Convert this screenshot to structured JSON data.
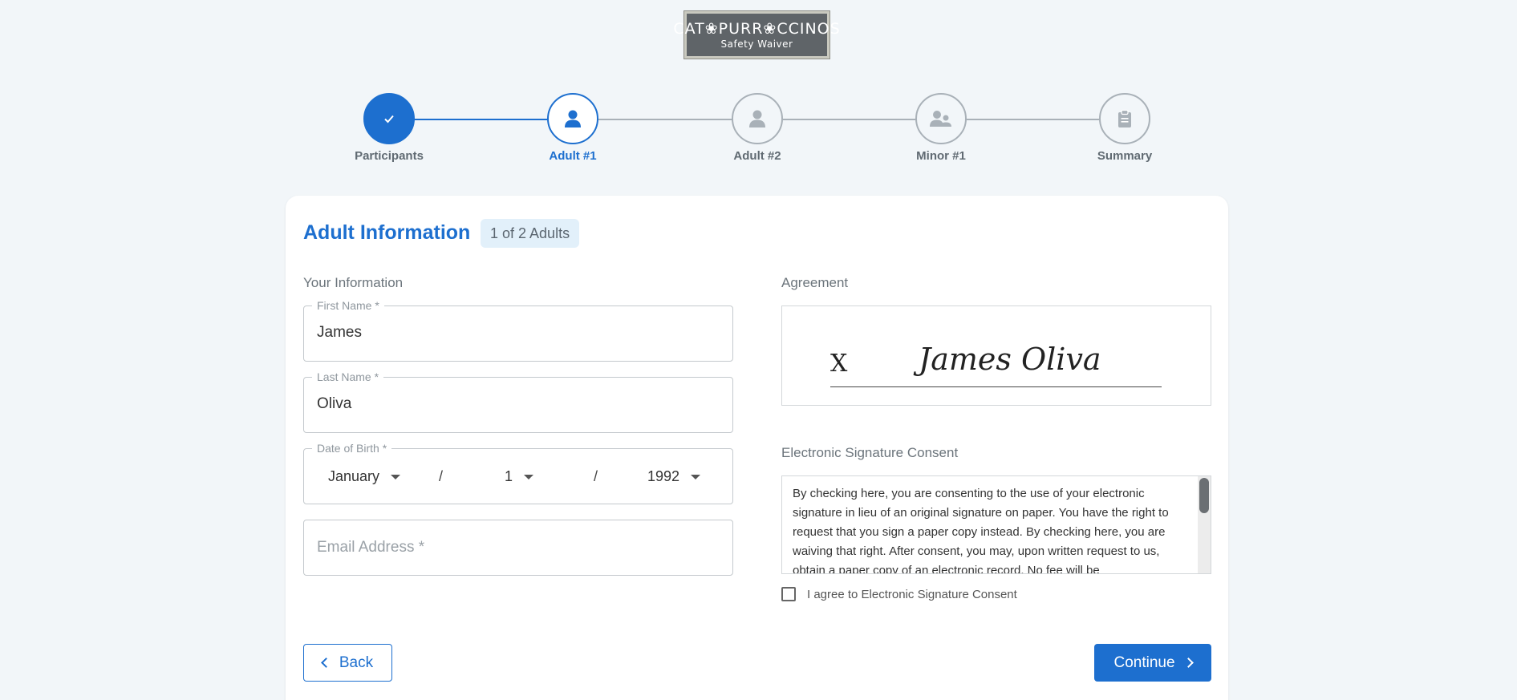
{
  "logo": {
    "title": "CAT❀PURR❀CCINOS",
    "subtitle": "Safety Waiver"
  },
  "stepper": {
    "steps": [
      {
        "label": "Participants",
        "state": "done",
        "icon": "check-icon"
      },
      {
        "label": "Adult #1",
        "state": "current",
        "icon": "person-icon"
      },
      {
        "label": "Adult #2",
        "state": "upcoming",
        "icon": "person-icon"
      },
      {
        "label": "Minor #1",
        "state": "upcoming",
        "icon": "person-child-icon"
      },
      {
        "label": "Summary",
        "state": "upcoming",
        "icon": "clipboard-icon"
      }
    ]
  },
  "card": {
    "title": "Adult Information",
    "badge": "1 of 2 Adults",
    "your_info_label": "Your Information",
    "first_name": {
      "label": "First Name *",
      "value": "James"
    },
    "last_name": {
      "label": "Last Name *",
      "value": "Oliva"
    },
    "dob": {
      "label": "Date of Birth *",
      "month": "January",
      "day": "1",
      "year": "1992",
      "separator": "/"
    },
    "email": {
      "placeholder": "Email Address *",
      "value": ""
    },
    "agreement_label": "Agreement",
    "signature": {
      "prefix": "X",
      "name": "James Oliva"
    },
    "consent_label": "Electronic Signature Consent",
    "consent_text": "By checking here, you are consenting to the use of your electronic signature in lieu of an original signature on paper. You have the right to request that you sign a paper copy instead. By checking here, you are waiving that right. After consent, you may, upon written request to us, obtain a paper copy of an electronic record. No fee will be",
    "agree_label": "I agree to Electronic Signature Consent",
    "back_label": "Back",
    "continue_label": "Continue"
  },
  "colors": {
    "primary": "#1d6fcf",
    "muted": "#a9b1b8",
    "background": "#f2f6f9"
  }
}
